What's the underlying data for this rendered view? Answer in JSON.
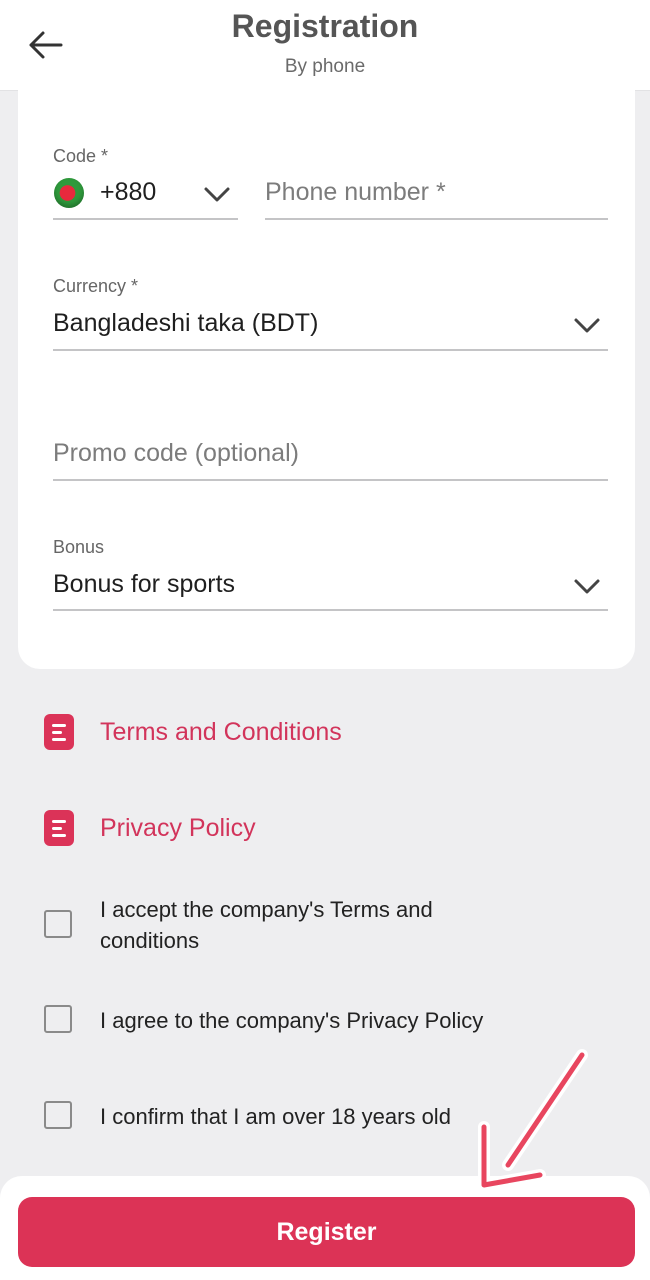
{
  "header": {
    "title": "Registration",
    "subtitle": "By phone",
    "back_icon": "arrow-left-icon"
  },
  "form": {
    "code": {
      "label": "Code *",
      "value": "+880",
      "flag": "bangladesh-flag"
    },
    "phone": {
      "placeholder": "Phone number *"
    },
    "currency": {
      "label": "Currency *",
      "value": "Bangladeshi taka (BDT)"
    },
    "promo": {
      "placeholder": "Promo code (optional)"
    },
    "bonus": {
      "label": "Bonus",
      "value": "Bonus for sports"
    }
  },
  "links": {
    "terms": "Terms and Conditions",
    "privacy": "Privacy Policy"
  },
  "checkboxes": [
    {
      "label": "I accept the company's Terms and conditions",
      "checked": false
    },
    {
      "label": "I agree to the company's Privacy Policy",
      "checked": false
    },
    {
      "label": "I confirm that I am over 18 years old",
      "checked": false
    }
  ],
  "register_label": "Register",
  "colors": {
    "accent": "#dc3356",
    "background": "#eeeef0",
    "card": "#ffffff"
  }
}
